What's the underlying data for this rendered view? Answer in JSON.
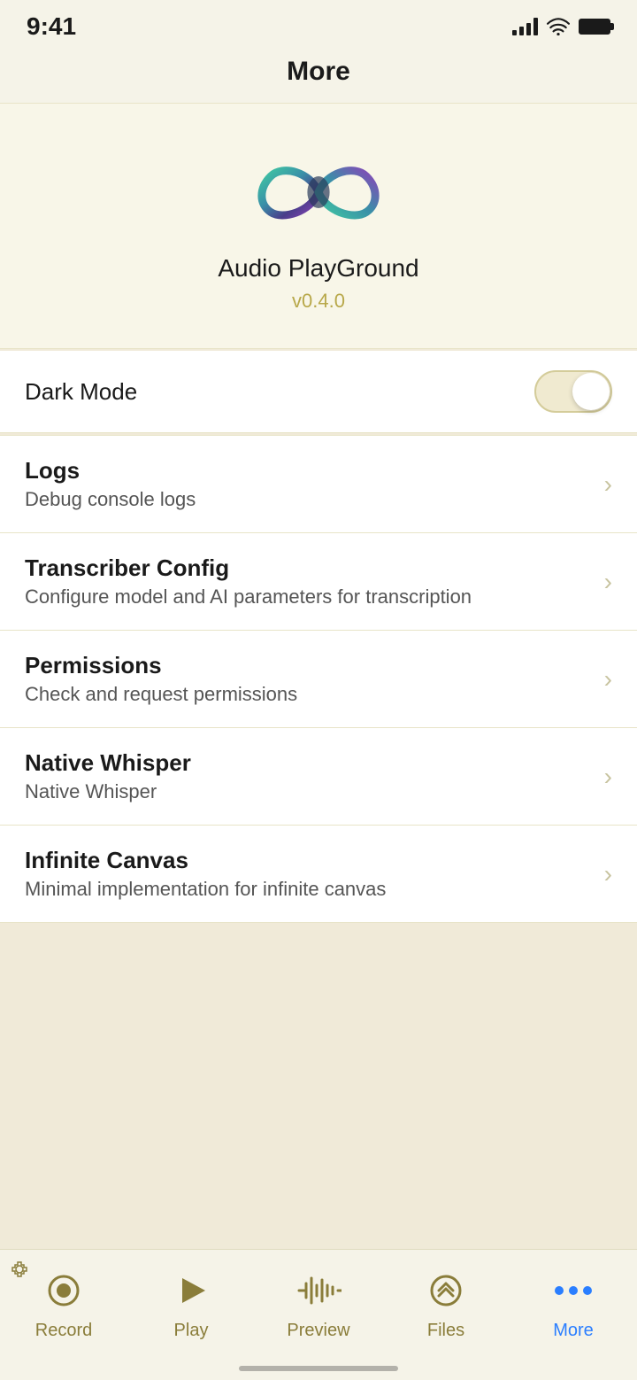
{
  "statusBar": {
    "time": "9:41",
    "signal": [
      4,
      8,
      12,
      16
    ],
    "wifi": true,
    "battery": true
  },
  "header": {
    "title": "More"
  },
  "appInfo": {
    "name": "Audio PlayGround",
    "version": "v0.4.0"
  },
  "darkMode": {
    "label": "Dark Mode",
    "enabled": false
  },
  "menuItems": [
    {
      "id": "logs",
      "title": "Logs",
      "subtitle": "Debug console logs"
    },
    {
      "id": "transcriber-config",
      "title": "Transcriber Config",
      "subtitle": "Configure model and AI parameters for transcription"
    },
    {
      "id": "permissions",
      "title": "Permissions",
      "subtitle": "Check and request permissions"
    },
    {
      "id": "native-whisper",
      "title": "Native Whisper",
      "subtitle": "Native Whisper"
    },
    {
      "id": "infinite-canvas",
      "title": "Infinite Canvas",
      "subtitle": "Minimal implementation for infinite canvas"
    }
  ],
  "tabBar": {
    "items": [
      {
        "id": "record",
        "label": "Record",
        "active": false
      },
      {
        "id": "play",
        "label": "Play",
        "active": false
      },
      {
        "id": "preview",
        "label": "Preview",
        "active": false
      },
      {
        "id": "files",
        "label": "Files",
        "active": false
      },
      {
        "id": "more",
        "label": "More",
        "active": true
      }
    ]
  }
}
